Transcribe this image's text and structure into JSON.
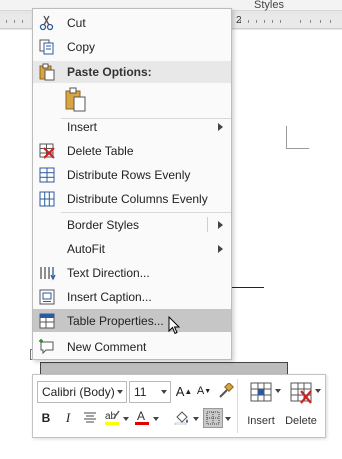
{
  "header": {
    "styles_label": "Styles"
  },
  "ruler": {
    "number": "2"
  },
  "context_menu": {
    "items": [
      {
        "label": "Cut",
        "icon": "scissors-icon"
      },
      {
        "label": "Copy",
        "icon": "copy-icon"
      },
      {
        "label": "Paste Options:",
        "icon": "clipboard-icon"
      },
      {
        "label": "Insert",
        "icon": "",
        "submenu": true
      },
      {
        "label": "Delete Table",
        "icon": "delete-table-icon"
      },
      {
        "label": "Distribute Rows Evenly",
        "icon": "distribute-rows-icon"
      },
      {
        "label": "Distribute Columns Evenly",
        "icon": "distribute-columns-icon"
      },
      {
        "label": "Border Styles",
        "icon": "",
        "submenu": true
      },
      {
        "label": "AutoFit",
        "icon": "",
        "submenu": true
      },
      {
        "label": "Text Direction...",
        "icon": "text-direction-icon"
      },
      {
        "label": "Insert Caption...",
        "icon": "insert-caption-icon"
      },
      {
        "label": "Table Properties...",
        "icon": "table-properties-icon",
        "highlighted": true
      },
      {
        "label": "New Comment",
        "icon": "new-comment-icon"
      }
    ]
  },
  "mini_toolbar": {
    "font_name": "Calibri (Body)",
    "font_size": "11",
    "bold": "B",
    "italic": "I",
    "insert_label": "Insert",
    "delete_label": "Delete",
    "highlight_color": "#ffff00",
    "font_color": "#e00000"
  }
}
